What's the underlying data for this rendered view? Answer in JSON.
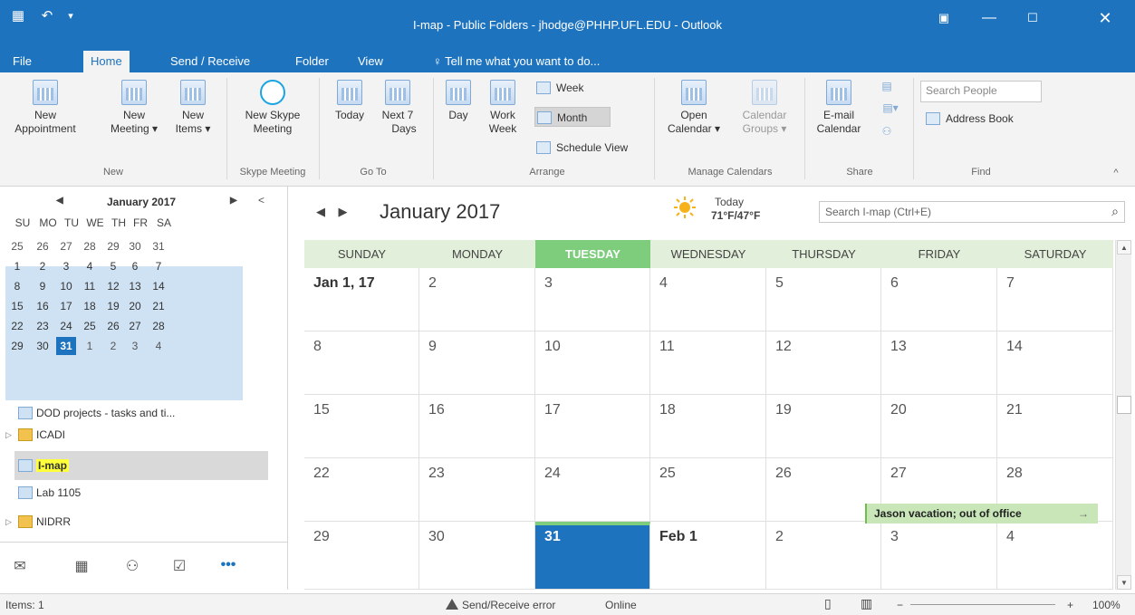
{
  "titlebar": {
    "title": "I-map - Public Folders - jhodge@PHHP.UFL.EDU - Outlook",
    "icons": [
      "outlook-icon",
      "undo-icon",
      "quick-access-dropdown-icon"
    ],
    "window_buttons": [
      "ribbon-display-icon",
      "minimize-icon",
      "maximize-icon",
      "close-icon"
    ]
  },
  "tabs": [
    "File",
    "Home",
    "Send / Receive",
    "Folder",
    "View"
  ],
  "tell_me": "Tell me what you want to do...",
  "ribbon": {
    "new_appointment": "New Appointment",
    "new_appointment_l1": "New",
    "new_appointment_l2": "Appointment",
    "new_meeting_l1": "New",
    "new_meeting_l2": "Meeting ▾",
    "new_items_l1": "New",
    "new_items_l2": "Items ▾",
    "group_new": "New",
    "skype_l1": "New Skype",
    "skype_l2": "Meeting",
    "group_skype": "Skype Meeting",
    "today": "Today",
    "next7_l1": "Next 7",
    "next7_l2": "Days",
    "group_goto": "Go To",
    "day": "Day",
    "work_week_l1": "Work",
    "work_week_l2": "Week",
    "week": "Week",
    "month": "Month",
    "schedule_view": "Schedule View",
    "group_arrange": "Arrange",
    "open_cal_l1": "Open",
    "open_cal_l2": "Calendar ▾",
    "cal_groups_l1": "Calendar",
    "cal_groups_l2": "Groups ▾",
    "group_manage": "Manage Calendars",
    "email_cal_l1": "E-mail",
    "email_cal_l2": "Calendar",
    "group_share": "Share",
    "search_people": "Search People",
    "address_book": "Address Book",
    "group_find": "Find"
  },
  "mini_calendar": {
    "month": "January 2017",
    "days": [
      "SU",
      "MO",
      "TU",
      "WE",
      "TH",
      "FR",
      "SA"
    ],
    "weeks": [
      [
        "25",
        "26",
        "27",
        "28",
        "29",
        "30",
        "31"
      ],
      [
        "1",
        "2",
        "3",
        "4",
        "5",
        "6",
        "7"
      ],
      [
        "8",
        "9",
        "10",
        "11",
        "12",
        "13",
        "14"
      ],
      [
        "15",
        "16",
        "17",
        "18",
        "19",
        "20",
        "21"
      ],
      [
        "22",
        "23",
        "24",
        "25",
        "26",
        "27",
        "28"
      ],
      [
        "29",
        "30",
        "31",
        "1",
        "2",
        "3",
        "4"
      ]
    ],
    "today": "31"
  },
  "folders": [
    {
      "label": "DOD projects - tasks and ti...",
      "icon": "calendar-folder-icon",
      "expandable": false
    },
    {
      "label": "ICADI",
      "icon": "folder-icon",
      "expandable": true
    },
    {
      "label": "I-map",
      "icon": "calendar-folder-icon",
      "expandable": false,
      "selected": true
    },
    {
      "label": "Lab 1105",
      "icon": "calendar-folder-icon",
      "expandable": false
    },
    {
      "label": "NIDRR",
      "icon": "folder-icon",
      "expandable": true
    }
  ],
  "bottom_nav": [
    "mail-icon",
    "calendar-icon",
    "people-icon",
    "tasks-icon",
    "more-icon"
  ],
  "calendar": {
    "title": "January 2017",
    "weather_label": "Today",
    "weather_temp": "71°F/47°F",
    "search_placeholder": "Search I-map (Ctrl+E)",
    "day_headers": [
      "SUNDAY",
      "MONDAY",
      "TUESDAY",
      "WEDNESDAY",
      "THURSDAY",
      "FRIDAY",
      "SATURDAY"
    ],
    "today_column": 2,
    "weeks": [
      [
        "Jan 1, 17",
        "2",
        "3",
        "4",
        "5",
        "6",
        "7"
      ],
      [
        "8",
        "9",
        "10",
        "11",
        "12",
        "13",
        "14"
      ],
      [
        "15",
        "16",
        "17",
        "18",
        "19",
        "20",
        "21"
      ],
      [
        "22",
        "23",
        "24",
        "25",
        "26",
        "27",
        "28"
      ],
      [
        "29",
        "30",
        "31",
        "Feb 1",
        "2",
        "3",
        "4"
      ]
    ],
    "event": "Jason vacation; out of office",
    "event_arrow": "→"
  },
  "statusbar": {
    "items": "Items: 1",
    "error": "Send/Receive error",
    "online": "Online",
    "zoom": "100%"
  },
  "colors": {
    "accent": "#1e73be",
    "today_header": "#7dcd7d",
    "header_bg": "#e2efda",
    "event_bg": "#c8e6b8",
    "highlight": "#ffff3a"
  }
}
